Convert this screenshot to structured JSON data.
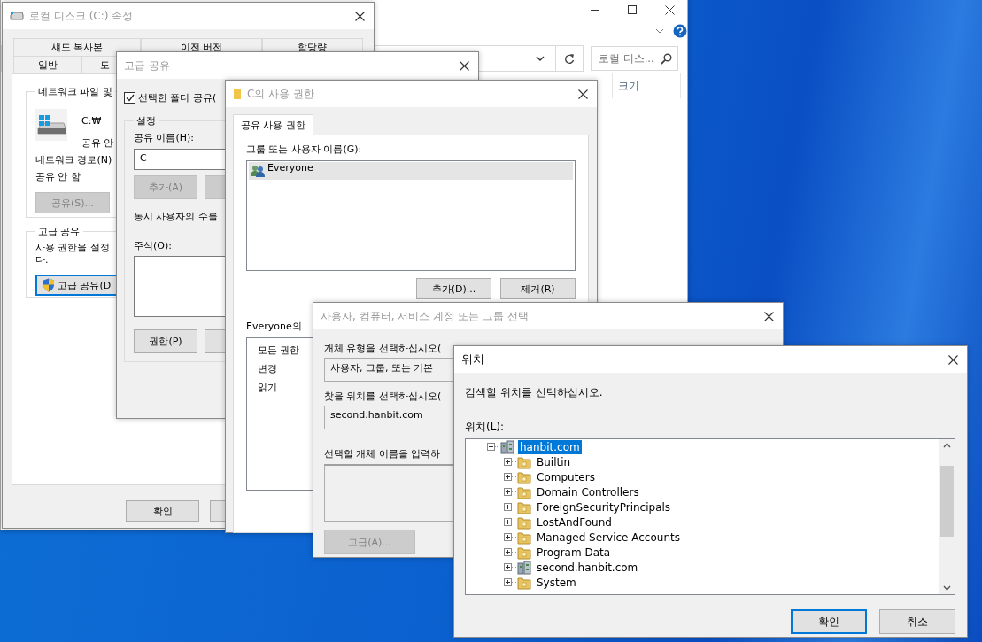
{
  "explorer": {
    "search": {
      "placeholder": "로컬 디스..."
    },
    "columns": [
      "크기"
    ]
  },
  "properties_dialog": {
    "title": "로컬 디스크 (C:) 속성",
    "active": false,
    "tab_rows": [
      [
        {
          "label": "섀도 복사본",
          "selected": false
        },
        {
          "label": "이전 버전",
          "selected": false
        },
        {
          "label": "할당량",
          "selected": false
        }
      ],
      [
        {
          "label": "일반",
          "selected": false
        },
        {
          "label": "도",
          "selected": false
        }
      ]
    ],
    "network_group": {
      "title": "네트워크 파일 및",
      "drive_path": "C:₩",
      "drive_status": "공유 안",
      "path_label": "네트워크 경로(N)",
      "path_value": "공유 안 함",
      "share_button": {
        "label": "공유(S)...",
        "disabled": true
      }
    },
    "advanced_group": {
      "title": "고급 공유",
      "description_lines": [
        "사용 권한을 설정",
        "다."
      ],
      "button": {
        "label": "고급 공유(D",
        "focused": true
      }
    },
    "ok_button": {
      "label": "확인"
    }
  },
  "advanced_sharing_dialog": {
    "title": "고급 공유",
    "active": false,
    "share_checkbox": {
      "label": "선택한 폴더 공유(",
      "checked": true
    },
    "settings_group": {
      "title": "설정",
      "share_name_label": "공유 이름(H):",
      "share_name_value": "C",
      "add_button": {
        "label": "추가(A)",
        "disabled": true
      },
      "users_label": "동시 사용자의 수를",
      "comment_label": "주석(O):",
      "permissions_button": {
        "label": "권한(P)",
        "disabled": false
      }
    }
  },
  "permissions_dialog": {
    "title": "C의 사용 권한",
    "active": false,
    "tabs": [
      {
        "label": "공유 사용 권한",
        "selected": true
      }
    ],
    "users_label": "그룹 또는 사용자 이름(G):",
    "users": [
      {
        "name": "Everyone",
        "selected": true
      }
    ],
    "buttons": [
      {
        "label": "추가(D)..."
      },
      {
        "label": "제거(R)"
      }
    ],
    "permissions_label": "Everyone의",
    "permissions": [
      "모든 권한",
      "변경",
      "읽기"
    ]
  },
  "select_dialog": {
    "title": "사용자, 컴퓨터, 서비스 계정 또는 그룹 선택",
    "active": false,
    "object_type_label": "개체 유형을 선택하십시오(",
    "object_type_value": "사용자, 그룹, 또는 기본",
    "location_label": "찾을 위치를 선택하십시오(",
    "location_value": "second.hanbit.com",
    "names_label": "선택할 개체 이름을 입력하",
    "advanced_button": {
      "label": "고급(A)...",
      "disabled": true
    }
  },
  "location_dialog": {
    "title": "위치",
    "active": true,
    "prompt": "검색할 위치를 선택하십시오.",
    "tree_label": "위치(L):",
    "tree": [
      {
        "label": "hanbit.com",
        "kind": "domain",
        "expanded": true,
        "selected": true,
        "children": [
          {
            "label": "Builtin",
            "kind": "folder",
            "expanded": false,
            "selected": false
          },
          {
            "label": "Computers",
            "kind": "folder",
            "expanded": false,
            "selected": false
          },
          {
            "label": "Domain Controllers",
            "kind": "folder",
            "expanded": false,
            "selected": false
          },
          {
            "label": "ForeignSecurityPrincipals",
            "kind": "folder",
            "expanded": false,
            "selected": false
          },
          {
            "label": "LostAndFound",
            "kind": "folder",
            "expanded": false,
            "selected": false
          },
          {
            "label": "Managed Service Accounts",
            "kind": "folder",
            "expanded": false,
            "selected": false
          },
          {
            "label": "Program Data",
            "kind": "folder",
            "expanded": false,
            "selected": false
          },
          {
            "label": "second.hanbit.com",
            "kind": "domain",
            "expanded": false,
            "selected": false
          },
          {
            "label": "System",
            "kind": "folder",
            "expanded": false,
            "selected": false
          }
        ]
      }
    ],
    "buttons": [
      {
        "label": "확인",
        "focused": true
      },
      {
        "label": "취소",
        "focused": false
      }
    ]
  }
}
